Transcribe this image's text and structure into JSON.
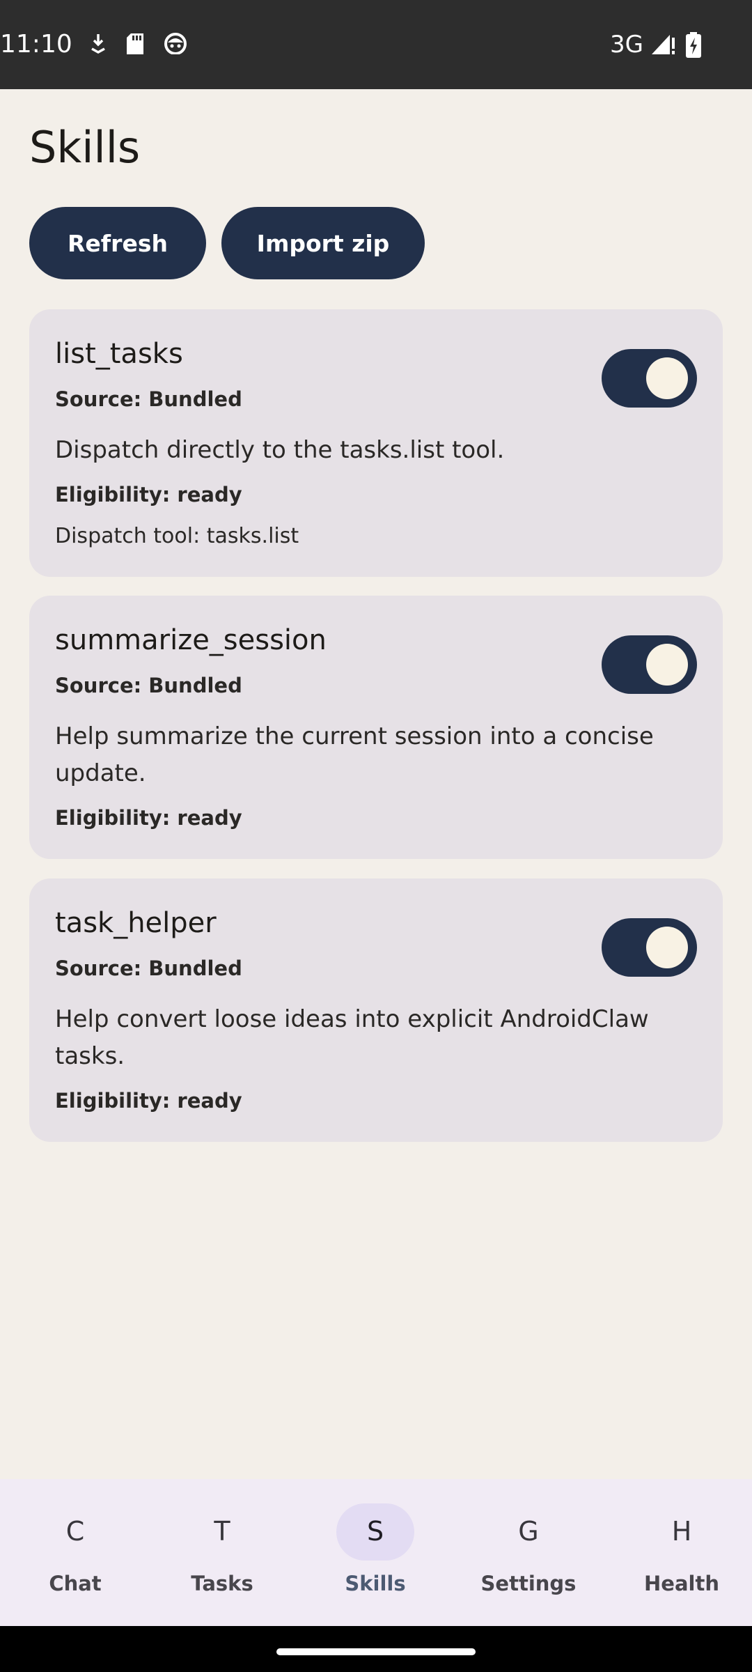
{
  "status_bar": {
    "time": "11:10",
    "network": "3G",
    "icons": [
      "download-icon",
      "sd-card-icon",
      "android-debug-icon",
      "signal-icon",
      "battery-charging-icon"
    ]
  },
  "page": {
    "title": "Skills"
  },
  "actions": {
    "refresh_label": "Refresh",
    "import_label": "Import zip"
  },
  "skills": [
    {
      "name": "list_tasks",
      "source": "Source: Bundled",
      "description": "Dispatch directly to the tasks.list tool.",
      "eligibility": "Eligibility: ready",
      "dispatch_tool": "Dispatch tool: tasks.list",
      "enabled": true
    },
    {
      "name": "summarize_session",
      "source": "Source: Bundled",
      "description": "Help summarize the current session into a concise update.",
      "eligibility": "Eligibility: ready",
      "enabled": true
    },
    {
      "name": "task_helper",
      "source": "Source: Bundled",
      "description": "Help convert loose ideas into explicit AndroidClaw tasks.",
      "eligibility": "Eligibility: ready",
      "enabled": true
    }
  ],
  "nav": {
    "items": [
      {
        "letter": "C",
        "label": "Chat"
      },
      {
        "letter": "T",
        "label": "Tasks"
      },
      {
        "letter": "S",
        "label": "Skills"
      },
      {
        "letter": "G",
        "label": "Settings"
      },
      {
        "letter": "H",
        "label": "Health"
      }
    ],
    "active": "Skills"
  },
  "colors": {
    "background": "#f3efe9",
    "accent": "#22304a",
    "card": "#e6e1e6",
    "nav_background": "#f1ebf5",
    "nav_indicator": "#e3dcf3"
  }
}
